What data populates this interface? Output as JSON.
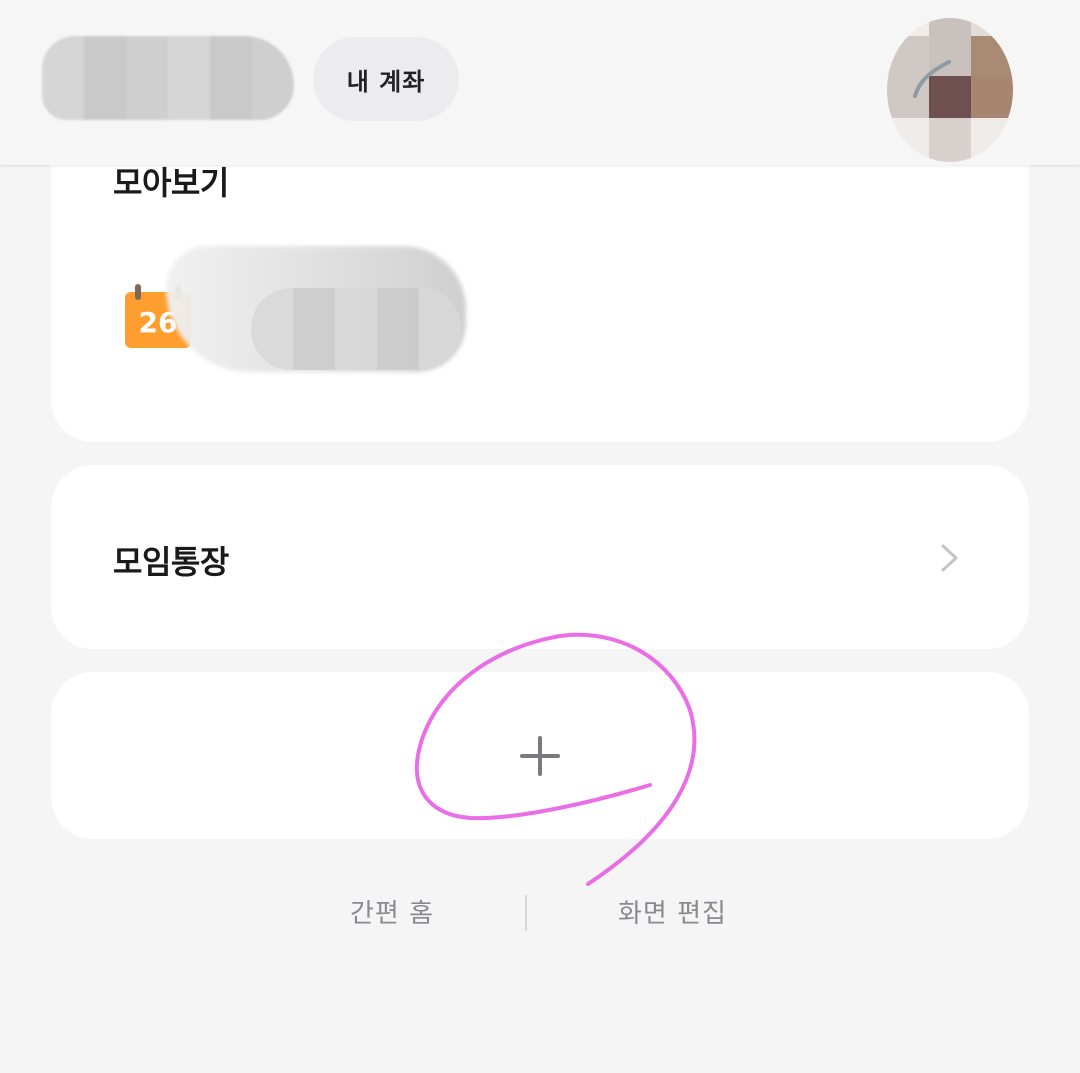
{
  "header": {
    "account_button_label": "내 계좌"
  },
  "summary_card": {
    "title": "모아보기",
    "calendar_day": "26"
  },
  "group_account_card": {
    "title": "모임통장"
  },
  "bottom_links": {
    "simple_home": "간편 홈",
    "edit_screen": "화면 편집"
  },
  "icons": {
    "calendar": "calendar-icon",
    "chevron": "chevron-right-icon",
    "add": "plus-icon"
  },
  "colors": {
    "background": "#f5f5f6",
    "card": "#ffffff",
    "calendar_orange": "#ff9d2e",
    "annotation_pink": "#e75ee6"
  }
}
